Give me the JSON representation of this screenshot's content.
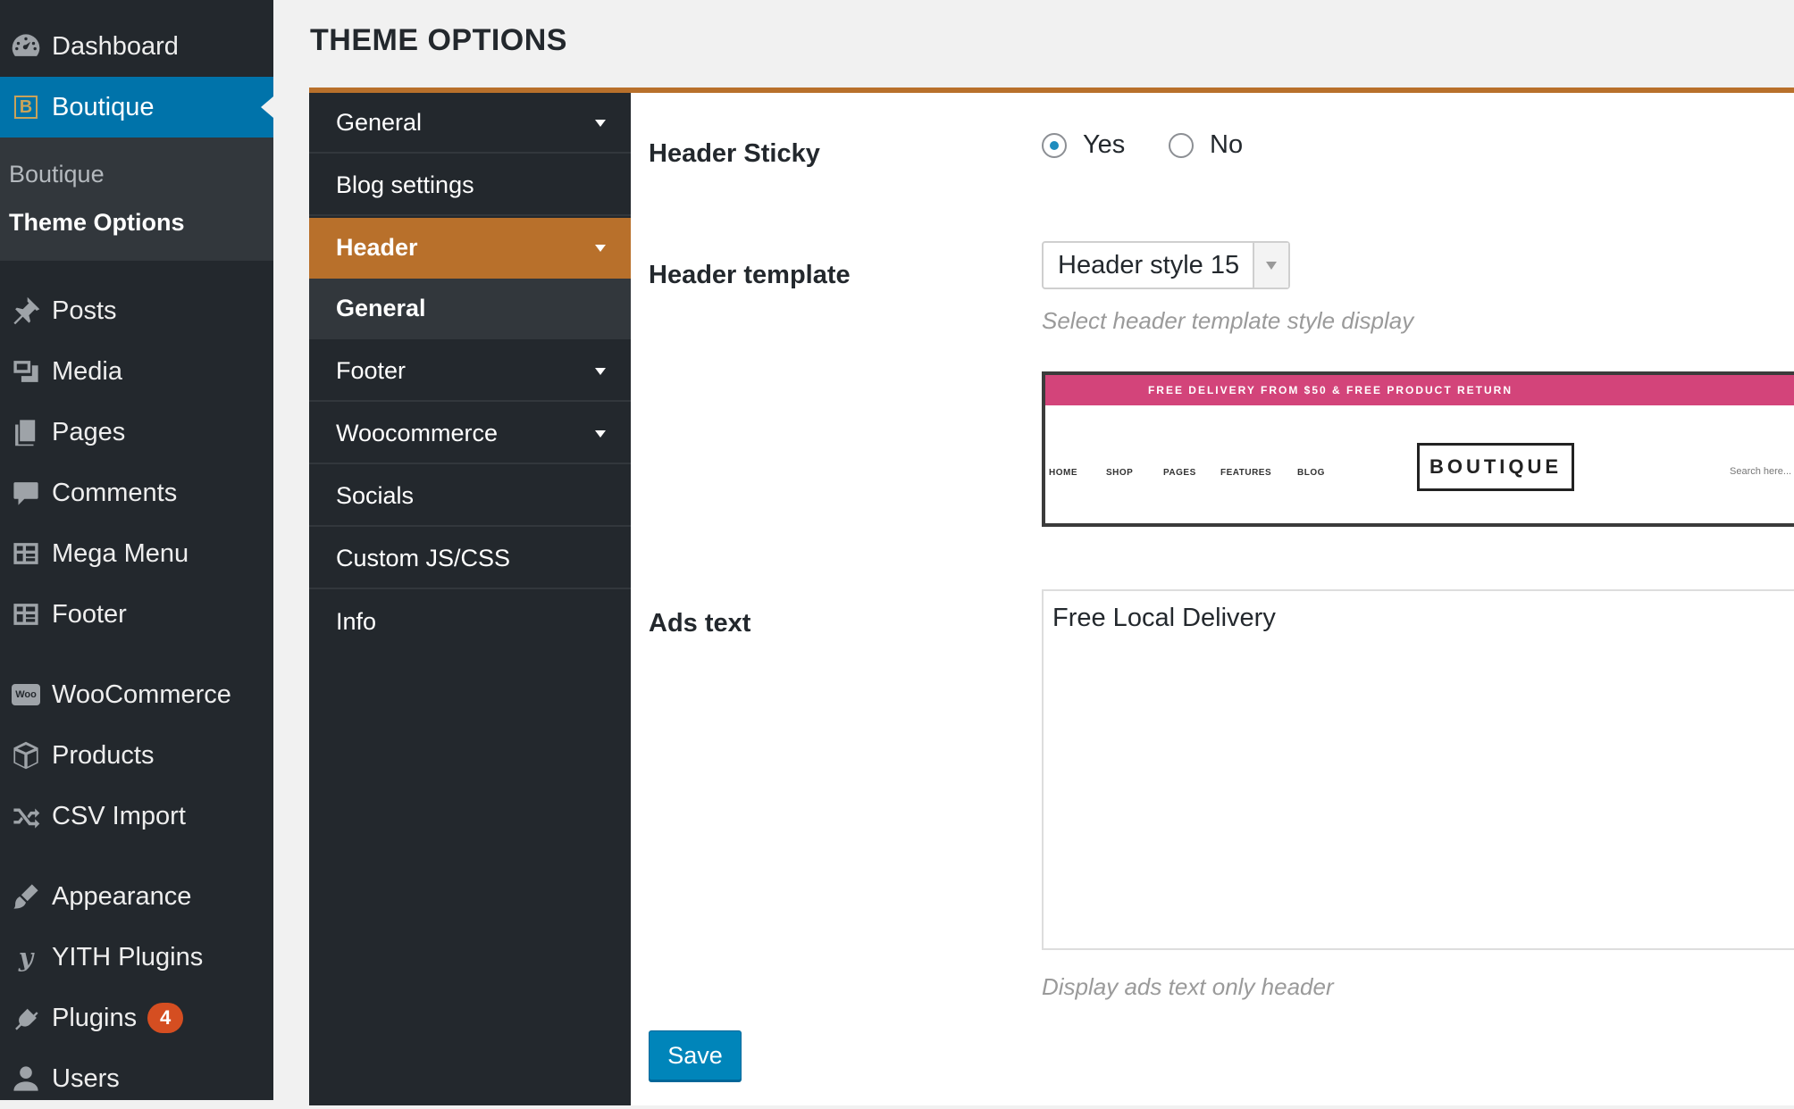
{
  "page": {
    "title": "THEME OPTIONS"
  },
  "sidebar": {
    "items": [
      {
        "label": "Dashboard",
        "icon": "dashboard-icon"
      },
      {
        "label": "Boutique",
        "icon": "boutique-logo-icon"
      },
      {
        "label": "Posts",
        "icon": "pin-icon"
      },
      {
        "label": "Media",
        "icon": "media-icon"
      },
      {
        "label": "Pages",
        "icon": "pages-icon"
      },
      {
        "label": "Comments",
        "icon": "comment-icon"
      },
      {
        "label": "Mega Menu",
        "icon": "grid-icon"
      },
      {
        "label": "Footer",
        "icon": "grid-icon"
      },
      {
        "label": "WooCommerce",
        "icon": "woo-icon"
      },
      {
        "label": "Products",
        "icon": "box-icon"
      },
      {
        "label": "CSV Import",
        "icon": "shuffle-icon"
      },
      {
        "label": "Appearance",
        "icon": "brush-icon"
      },
      {
        "label": "YITH Plugins",
        "icon": "yith-icon"
      },
      {
        "label": "Plugins",
        "icon": "plug-icon",
        "badge": "4"
      },
      {
        "label": "Users",
        "icon": "user-icon"
      }
    ],
    "submenu": [
      {
        "label": "Boutique"
      },
      {
        "label": "Theme Options"
      }
    ],
    "boutique_badge_letter": "B"
  },
  "options_nav": {
    "tabs": [
      {
        "label": "General"
      },
      {
        "label": "Blog settings"
      },
      {
        "label": "Header"
      },
      {
        "label": "General"
      },
      {
        "label": "Footer"
      },
      {
        "label": "Woocommerce"
      },
      {
        "label": "Socials"
      },
      {
        "label": "Custom JS/CSS"
      },
      {
        "label": "Info"
      }
    ]
  },
  "header_sticky": {
    "label": "Header Sticky",
    "options": [
      "Yes",
      "No"
    ],
    "selected": "Yes"
  },
  "header_template": {
    "label": "Header template",
    "value": "Header style 15",
    "description": "Select header template style display"
  },
  "preview": {
    "bar_text": "FREE DELIVERY FROM $50 & FREE PRODUCT RETURN",
    "nav": [
      "HOME",
      "SHOP",
      "PAGES",
      "FEATURES",
      "BLOG"
    ],
    "logo": "BOUTIQUE",
    "search": "Search here..."
  },
  "ads_text": {
    "label": "Ads text",
    "value": "Free Local Delivery",
    "description": "Display ads text only header"
  },
  "actions": {
    "save_label": "Save"
  },
  "colors": {
    "sidebar": "#23282d",
    "active_menu": "#0073aa",
    "accent": "#b8702b",
    "promo_bar": "#d3447a",
    "button": "#0085ba"
  }
}
